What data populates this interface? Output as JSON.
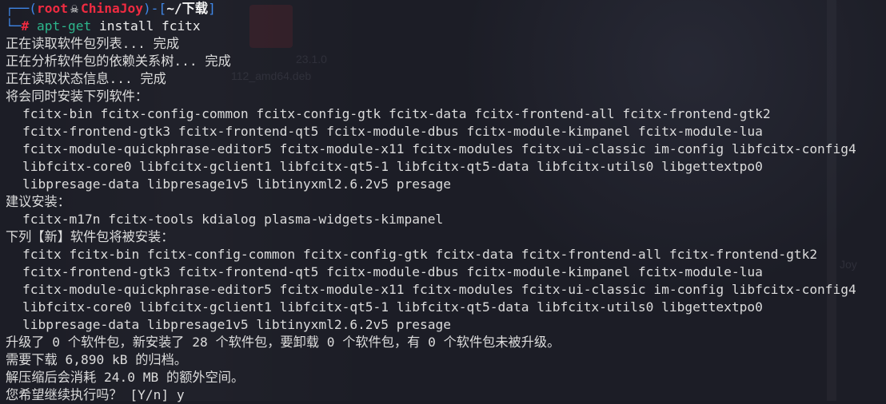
{
  "prompt": {
    "user": "root",
    "host": "ChinaJoy",
    "path": "~/下载",
    "skull_icon": "☠",
    "hash": "#",
    "command": "apt-get",
    "args": "install fcitx"
  },
  "output": {
    "reading_lists": "正在读取软件包列表... 完成",
    "dependency_tree": "正在分析软件包的依赖关系树... 完成",
    "reading_status": "正在读取状态信息... 完成",
    "will_install_header": "将会同时安装下列软件：",
    "will_install_lines": [
      "fcitx-bin fcitx-config-common fcitx-config-gtk fcitx-data fcitx-frontend-all fcitx-frontend-gtk2",
      "fcitx-frontend-gtk3 fcitx-frontend-qt5 fcitx-module-dbus fcitx-module-kimpanel fcitx-module-lua",
      "fcitx-module-quickphrase-editor5 fcitx-module-x11 fcitx-modules fcitx-ui-classic im-config libfcitx-config4",
      "libfcitx-core0 libfcitx-gclient1 libfcitx-qt5-1 libfcitx-qt5-data libfcitx-utils0 libgettextpo0",
      "libpresage-data libpresage1v5 libtinyxml2.6.2v5 presage"
    ],
    "suggested_header": "建议安装：",
    "suggested_lines": [
      "fcitx-m17n fcitx-tools kdialog plasma-widgets-kimpanel"
    ],
    "new_header": "下列【新】软件包将被安装：",
    "new_lines": [
      "fcitx fcitx-bin fcitx-config-common fcitx-config-gtk fcitx-data fcitx-frontend-all fcitx-frontend-gtk2",
      "fcitx-frontend-gtk3 fcitx-frontend-qt5 fcitx-module-dbus fcitx-module-kimpanel fcitx-module-lua",
      "fcitx-module-quickphrase-editor5 fcitx-module-x11 fcitx-modules fcitx-ui-classic im-config libfcitx-config4",
      "libfcitx-core0 libfcitx-gclient1 libfcitx-qt5-1 libfcitx-qt5-data libfcitx-utils0 libgettextpo0",
      "libpresage-data libpresage1v5 libtinyxml2.6.2v5 presage"
    ],
    "summary": "升级了 0 个软件包，新安装了 28 个软件包，要卸载 0 个软件包，有 0 个软件包未被升级。",
    "download_size": "需要下载 6,890 kB 的归档。",
    "disk_usage": "解压缩后会消耗 24.0 MB 的额外空间。",
    "confirm_prompt": "您希望继续执行吗？ [Y/n] y"
  },
  "background": {
    "ghost_labels": [
      "23.1.0",
      "112_amd64.deb",
      "Joy"
    ]
  },
  "colors": {
    "background": "#1c1d26",
    "prompt_blue": "#3f87e8",
    "prompt_red": "#ef2b41",
    "command_green": "#2db68c",
    "text": "#dcdcdc"
  }
}
